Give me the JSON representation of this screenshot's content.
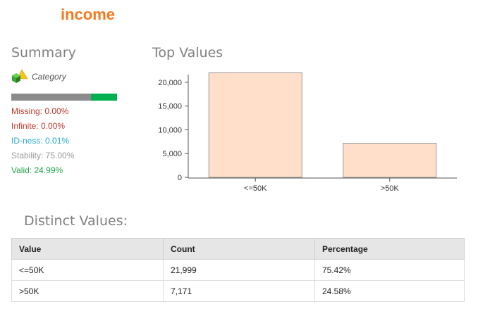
{
  "title": "income",
  "summary": {
    "heading": "Summary",
    "type_label": "Category",
    "type_icon": "category-shapes-icon",
    "valid_fraction": 0.2499,
    "colors": {
      "bar_bg": "#8c8c8c",
      "bar_fill": "#00b050"
    },
    "stats": {
      "missing": "Missing: 0.00%",
      "infinite": "Infinite: 0.00%",
      "idness": "ID-ness: 0.01%",
      "stability": "Stability: 75.00%",
      "valid": "Valid: 24.99%"
    }
  },
  "top_values": {
    "heading": "Top Values"
  },
  "chart_data": {
    "type": "bar",
    "categories": [
      "<=50K",
      ">50K"
    ],
    "values": [
      21999,
      7171
    ],
    "ylim": [
      0,
      22500
    ],
    "yticks": [
      0,
      5000,
      10000,
      15000,
      20000
    ],
    "ytick_labels": [
      "0",
      "5,000",
      "10,000",
      "15,000",
      "20,000"
    ],
    "bar_color": "#ffdfca",
    "bar_stroke": "#9a9a9a",
    "grid": false
  },
  "distinct": {
    "heading": "Distinct Values:",
    "columns": [
      "Value",
      "Count",
      "Percentage"
    ],
    "rows": [
      [
        "<=50K",
        "21,999",
        "75.42%"
      ],
      [
        ">50K",
        "7,171",
        "24.58%"
      ]
    ]
  }
}
